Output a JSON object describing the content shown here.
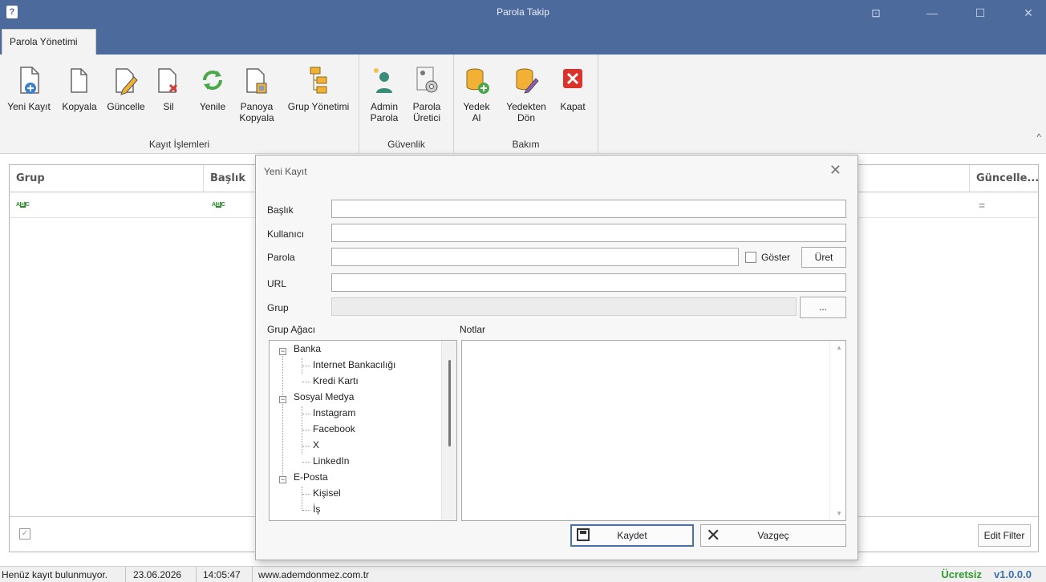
{
  "window": {
    "title": "Parola Takip",
    "app_icon": "?",
    "controls": {
      "pin": "⊡",
      "minimize": "—",
      "maximize": "☐",
      "close": "✕"
    }
  },
  "ribbon": {
    "active_tab": "Parola Yönetimi",
    "groups": [
      {
        "caption": "Kayıt İşlemleri",
        "buttons": [
          "Yeni Kayıt",
          "Kopyala",
          "Güncelle",
          "Sil",
          "Yenile",
          "Panoya Kopyala",
          "Grup Yönetimi"
        ]
      },
      {
        "caption": "Güvenlik",
        "buttons": [
          "Admin Parola",
          "Parola Üretici"
        ]
      },
      {
        "caption": "Bakım",
        "buttons": [
          "Yedek Al",
          "Yedekten Dön",
          "Kapat"
        ]
      }
    ],
    "labels": {
      "yeni_kayit": "Yeni Kayıt",
      "kopyala": "Kopyala",
      "guncelle": "Güncelle",
      "sil": "Sil",
      "yenile": "Yenile",
      "panoya_1": "Panoya",
      "panoya_2": "Kopyala",
      "grup_yonetimi": "Grup Yönetimi",
      "admin_1": "Admin",
      "admin_2": "Parola",
      "uretici_1": "Parola",
      "uretici_2": "Üretici",
      "yedek_1": "Yedek",
      "yedek_2": "Al",
      "yedekten_1": "Yedekten",
      "yedekten_2": "Dön",
      "kapat": "Kapat"
    },
    "collapse_icon": "^"
  },
  "grid": {
    "columns": [
      "Grup",
      "Başlık",
      "Güncelle..."
    ],
    "filter_row_icon": "ABC",
    "filter_row_eq": "=",
    "edit_filter_label": "Edit Filter",
    "footer_check": "✓"
  },
  "dialog": {
    "title": "Yeni Kayıt",
    "close": "✕",
    "fields": {
      "baslik": {
        "label": "Başlık",
        "value": ""
      },
      "kullanici": {
        "label": "Kullanıcı",
        "value": ""
      },
      "parola": {
        "label": "Parola",
        "value": ""
      },
      "url": {
        "label": "URL",
        "value": ""
      },
      "grup": {
        "label": "Grup",
        "value": ""
      }
    },
    "goster_label": "Göster",
    "uret_label": "Üret",
    "browse_label": "...",
    "tree_label": "Grup Ağacı",
    "notes_label": "Notlar",
    "tree": [
      {
        "label": "Banka",
        "children": [
          "Internet Bankacılığı",
          "Kredi Kartı"
        ]
      },
      {
        "label": "Sosyal Medya",
        "children": [
          "Instagram",
          "Facebook",
          "X",
          "LinkedIn"
        ]
      },
      {
        "label": "E-Posta",
        "children": [
          "Kişisel",
          "İş"
        ]
      }
    ],
    "tree_nodes": {
      "banka": "Banka",
      "internet": "Internet Bankacılığı",
      "kredi": "Kredi Kartı",
      "sosyal": "Sosyal Medya",
      "instagram": "Instagram",
      "facebook": "Facebook",
      "x": "X",
      "linkedin": "LinkedIn",
      "eposta": "E-Posta",
      "kisisel": "Kişisel",
      "is": "İş"
    },
    "save_label": "Kaydet",
    "cancel_label": "Vazgeç"
  },
  "statusbar": {
    "message": "Henüz kayıt bulunmuyor.",
    "date": "23.06.2026",
    "time": "14:05:47",
    "website": "www.ademdonmez.com.tr",
    "license": "Ücretsiz",
    "version": "v1.0.0.0"
  },
  "colors": {
    "titlebar": "#4d6a9d",
    "license": "#2e9a2e",
    "version": "#3a6fb0"
  }
}
